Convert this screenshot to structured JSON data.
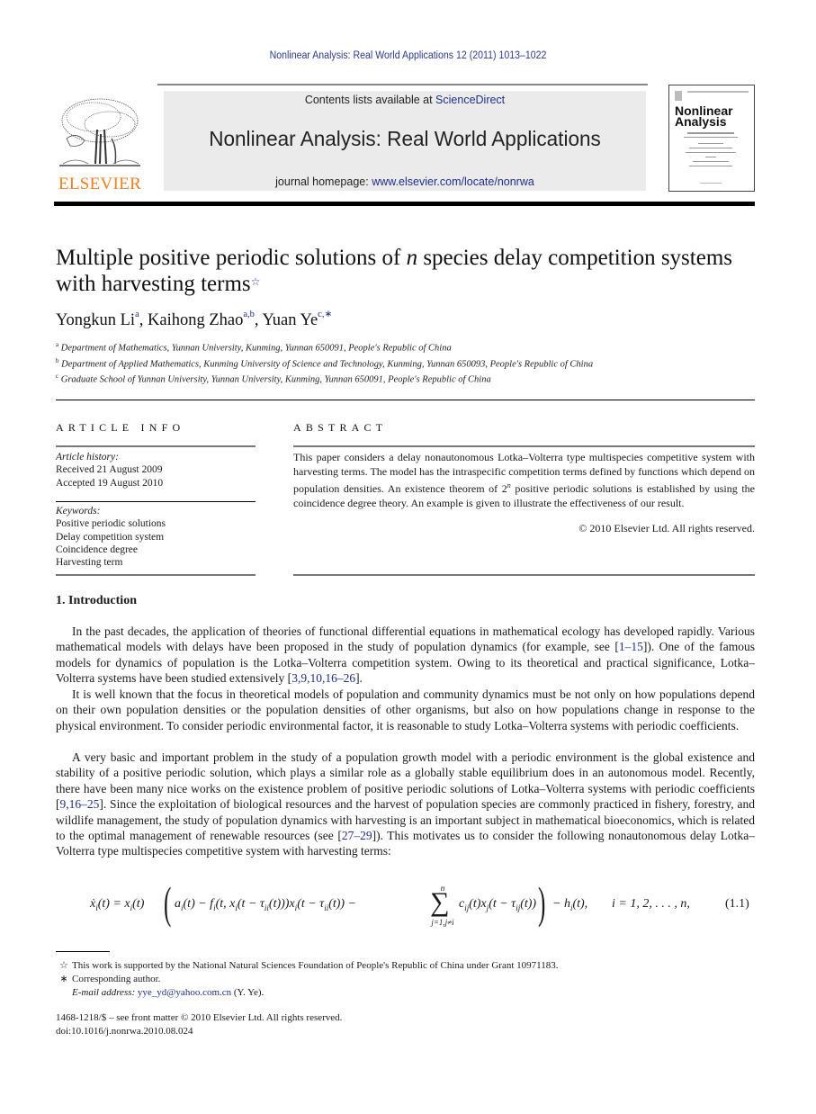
{
  "running_head": "Nonlinear Analysis: Real World Applications 12 (2011) 1013–1022",
  "masthead": {
    "publisher_logo_word": "ELSEVIER",
    "contents_prefix": "Contents lists available at ",
    "contents_link": "ScienceDirect",
    "journal_title": "Nonlinear Analysis: Real World Applications",
    "homepage_prefix": "journal homepage: ",
    "homepage_link": "www.elsevier.com/locate/nonrwa",
    "cover_title_line1": "Nonlinear",
    "cover_title_line2": "Analysis"
  },
  "article": {
    "title_part1": "Multiple positive periodic solutions of ",
    "title_italic": "n",
    "title_part2": " species delay competition systems with harvesting terms",
    "title_note_mark": "☆",
    "authors": [
      {
        "name": "Yongkun Li",
        "sup": "a"
      },
      {
        "name": "Kaihong Zhao",
        "sup": "a,b"
      },
      {
        "name": "Yuan Ye",
        "sup": "c,∗"
      }
    ],
    "affiliations": [
      {
        "mark": "a",
        "text": "Department of Mathematics, Yunnan University, Kunming, Yunnan 650091, People's Republic of China"
      },
      {
        "mark": "b",
        "text": "Department of Applied Mathematics, Kunming University of Science and Technology, Kunming, Yunnan 650093, People's Republic of China"
      },
      {
        "mark": "c",
        "text": "Graduate School of Yunnan University, Yunnan University, Kunming, Yunnan 650091, People's Republic of China"
      }
    ]
  },
  "article_info": {
    "heading": "ARTICLE INFO",
    "history_label": "Article history:",
    "received": "Received 21 August 2009",
    "accepted": "Accepted 19 August 2010",
    "keywords_label": "Keywords:",
    "keywords": [
      "Positive periodic solutions",
      "Delay competition system",
      "Coincidence degree",
      "Harvesting term"
    ]
  },
  "abstract": {
    "heading": "ABSTRACT",
    "text_part1": "This paper considers a delay nonautonomous Lotka–Volterra type multispecies competitive system with harvesting terms. The model has the intraspecific competition terms defined by functions which depend on population densities. An existence theorem of 2",
    "text_sup": "n",
    "text_part2": " positive periodic solutions is established by using the coincidence degree theory. An example is given to illustrate the effectiveness of our result.",
    "copyright": "© 2010 Elsevier Ltd. All rights reserved."
  },
  "introduction": {
    "heading": "1.  Introduction",
    "p1": {
      "a": "In the past decades, the application of theories of functional differential equations in mathematical ecology has developed rapidly. Various mathematical models with delays have been proposed in the study of population dynamics (for example, see [",
      "ref1": "1–15",
      "b": "]). One of the famous models for dynamics of population is the Lotka–Volterra competition system. Owing to its theoretical and practical significance, Lotka–Volterra systems have been studied extensively [",
      "ref2": "3,9,10,16–26",
      "c": "]."
    },
    "p2": "It is well known that the focus in theoretical models of population and community dynamics must be not only on how populations depend on their own population densities or the population densities of other organisms, but also on how populations change in response to the physical environment. To consider periodic environmental factor, it is reasonable to study Lotka–Volterra systems with periodic coefficients.",
    "p3": {
      "a": "A very basic and important problem in the study of a population growth model with a periodic environment is the global existence and stability of a positive periodic solution, which plays a similar role as a globally stable equilibrium does in an autonomous model. Recently, there have been many nice works on the existence problem of positive periodic solutions of Lotka–Volterra systems with periodic coefficients [",
      "ref1": "9,16–25",
      "b": "]. Since the exploitation of biological resources and the harvest of population species are commonly practiced in fishery, forestry, and wildlife management, the study of population dynamics with harvesting is an important subject in mathematical bioeconomics, which is related to the optimal management of renewable resources (see [",
      "ref2": "27–29",
      "c": "]). This motivates us to consider the following nonautonomous delay Lotka–Volterra type multispecies competitive system with harvesting terms:"
    },
    "equation": {
      "lhs": "ẋ",
      "sum_top": "n",
      "sum_bottom": "j=1,j≠i",
      "tail": "i = 1, 2, . . . , n,",
      "number": "(1.1)"
    }
  },
  "footnotes": {
    "support_mark": "☆",
    "support_text": "This work is supported by the National Natural Sciences Foundation of People's Republic of China under Grant 10971183.",
    "corr_mark": "∗",
    "corr_text": "Corresponding author.",
    "email_label": "E-mail address: ",
    "email": "yye_yd@yahoo.com.cn",
    "email_suffix": " (Y. Ye).",
    "issn_line": "1468-1218/$ – see front matter © 2010 Elsevier Ltd. All rights reserved.",
    "doi": "doi:10.1016/j.nonrwa.2010.08.024"
  }
}
